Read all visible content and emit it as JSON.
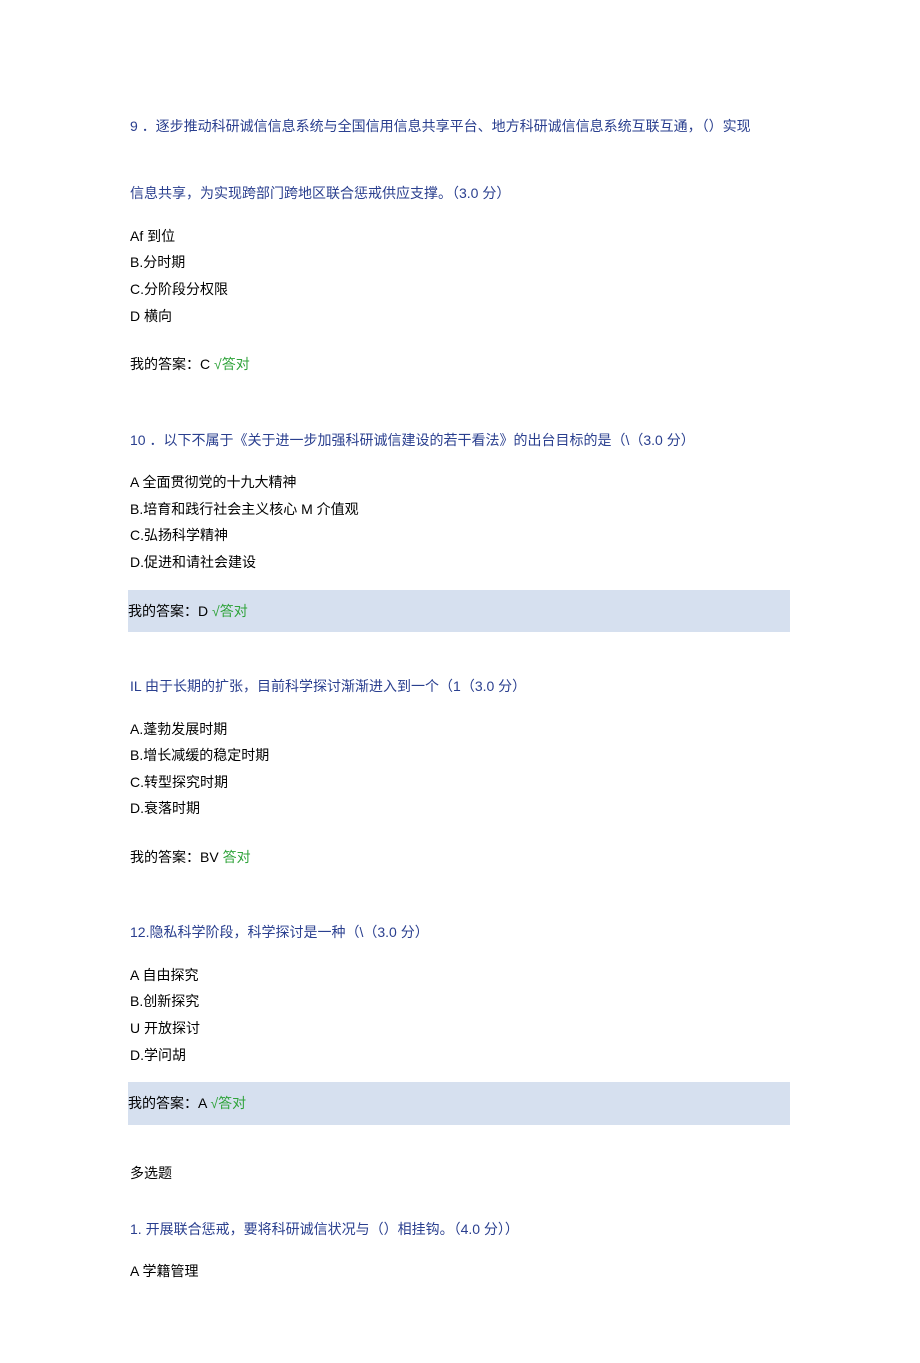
{
  "q9": {
    "num": "9",
    "text_a": "．逐步推动科研诚信信息系统与全国信用信息共享平台、地方科研诚信信息系统互联互通，（）实现",
    "text_b": "信息共享，为实现跨部门跨地区联合惩戒供应支撑。（3.0 分）",
    "opts": {
      "a": "Af 到位",
      "b": "B.分时期",
      "c": "C.分阶段分权限",
      "d": "D 横向"
    },
    "ans_prefix": "我的答案：",
    "ans_letter": "C",
    "ans_mark": " √",
    "ans_word": "答对"
  },
  "q10": {
    "num": "10",
    "text": "  ．以下不属于《关于进一步加强科研诚信建设的若干看法》的出台目标的是（\\（3.0 分）",
    "opts": {
      "a": "A 全面贯彻党的十九大精神",
      "b": "B.培育和践行社会主义核心 M 介值观",
      "c": "C.弘扬科学精神",
      "d": "D.促进和请社会建设"
    },
    "ans_prefix": "我的答案：",
    "ans_letter": "D",
    "ans_mark": " √",
    "ans_word": "答对"
  },
  "q11": {
    "num": "IL",
    "text": " 由于长期的扩张，目前科学探讨渐渐进入到一个（1（3.0 分）",
    "opts": {
      "a": "A.蓬勃发展时期",
      "b": "B.增长减缓的稳定时期",
      "c": "C.转型探究时期",
      "d": "D.衰落时期"
    },
    "ans_prefix": "我的答案：",
    "ans_letter": "BV",
    "ans_word": " 答对"
  },
  "q12": {
    "num": "12.",
    "text": "隐私科学阶段，科学探讨是一种（\\（3.0 分）",
    "opts": {
      "a": "A 自由探究",
      "b": "B.创新探究",
      "c": "U 开放探讨",
      "d": "D.学问胡"
    },
    "ans_prefix": "我的答案：",
    "ans_letter": "A",
    "ans_mark": " √",
    "ans_word": "答对"
  },
  "multi": {
    "title": "多选题",
    "q1": {
      "num": "1.",
      "text": " 开展联合惩戒，要将科研诚信状况与（）相挂钩。（4.0 分））",
      "opts": {
        "a": "A 学籍管理"
      }
    }
  }
}
